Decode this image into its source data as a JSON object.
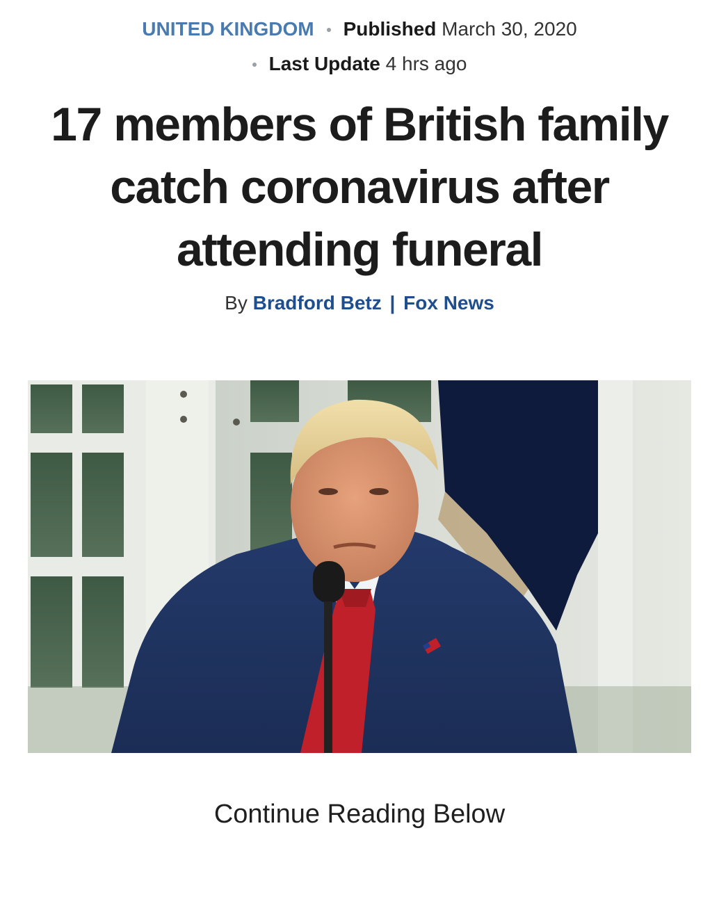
{
  "article": {
    "category": "UNITED KINGDOM",
    "published_label": "Published",
    "published_date": "March 30, 2020",
    "updated_label": "Last Update",
    "updated_value": "4 hrs ago",
    "headline_lines": [
      "17 members of British family",
      "catch coronavirus after",
      "attending funeral"
    ],
    "byline": {
      "prefix": "By",
      "author": "Bradford Betz",
      "separator": "|",
      "outlet": "Fox News"
    },
    "continue_label": "Continue Reading Below"
  },
  "colors": {
    "category": "#4a7bb0",
    "byline_link": "#1f4e8c",
    "headline": "#1c1c1c"
  }
}
